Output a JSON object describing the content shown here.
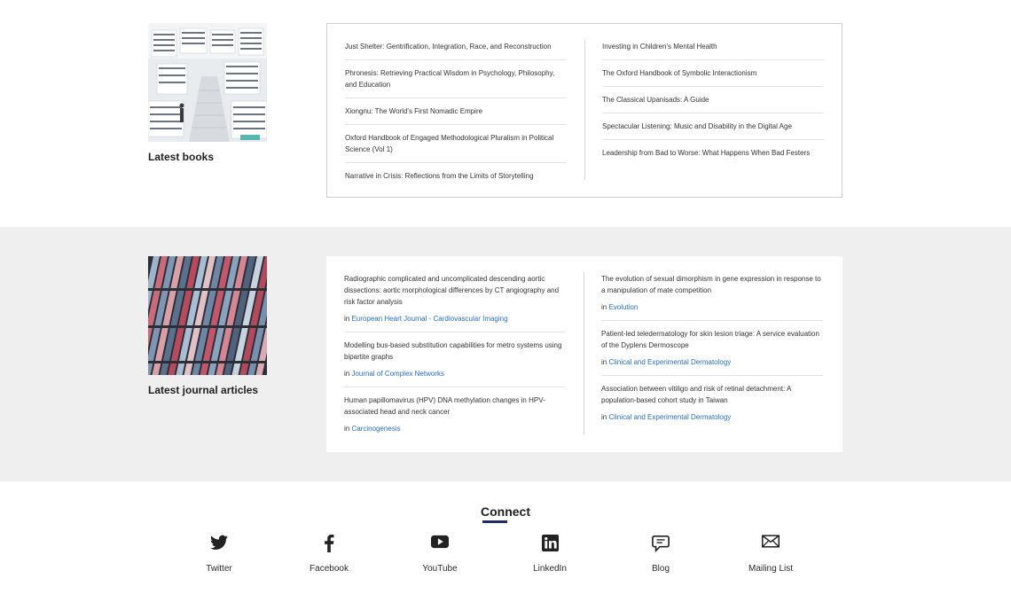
{
  "books_section": {
    "label": "Latest books",
    "left_items": [
      "Just Shelter: Gentrification, Integration, Race, and Reconstruction",
      "Phronesis: Retrieving Practical Wisdom in Psychology, Philosophy, and Education",
      "Xiongnu: The World's First Nomadic Empire",
      "Oxford Handbook of Engaged Methodological Pluralism in Political Science (Vol 1)",
      "Narrative in Crisis: Reflections from the Limits of Storytelling"
    ],
    "right_items": [
      "Investing in Children's Mental Health",
      "The Oxford Handbook of Symbolic Interactionism",
      "The Classical Upaniṣads: A Guide",
      "Spectacular Listening: Music and Disability in the Digital Age",
      "Leadership from Bad to Worse: What Happens When Bad Festers"
    ]
  },
  "articles_section": {
    "label": "Latest journal articles",
    "in_prefix": "in",
    "left_items": [
      {
        "title": "Radiographic complicated and uncomplicated descending aortic dissections: aortic morphological differences by CT angiography and risk factor analysis",
        "journal": "European Heart Journal - Cardiovascular Imaging"
      },
      {
        "title": "Modelling bus-based substitution capabilities for metro systems using bipartite graphs",
        "journal": "Journal of Complex Networks"
      },
      {
        "title": "Human papillomavirus (HPV) DNA methylation changes in HPV-associated head and neck cancer",
        "journal": "Carcinogenesis"
      }
    ],
    "right_items": [
      {
        "title": "The evolution of sexual dimorphism in gene expression in response to a manipulation of mate competition",
        "journal": "Evolution"
      },
      {
        "title": "Patient-led teledermatology for skin lesion triage: A service evaluation of the Dyplens Dermoscope",
        "journal": "Clinical and Experimental Dermatology"
      },
      {
        "title": "Association between vitiligo and risk of retinal detachment: A population-based cohort study in Taiwan",
        "journal": "Clinical and Experimental Dermatology"
      }
    ]
  },
  "connect": {
    "title": "Connect",
    "items": [
      {
        "label": "Twitter",
        "icon": "twitter-icon"
      },
      {
        "label": "Facebook",
        "icon": "facebook-icon"
      },
      {
        "label": "YouTube",
        "icon": "youtube-icon"
      },
      {
        "label": "LinkedIn",
        "icon": "linkedin-icon"
      },
      {
        "label": "Blog",
        "icon": "blog-icon"
      },
      {
        "label": "Mailing List",
        "icon": "mail-icon"
      }
    ]
  },
  "colors": {
    "link_blue": "#2a6db5",
    "accent_navy": "#1f2a6b",
    "section_gray": "#efefef"
  }
}
